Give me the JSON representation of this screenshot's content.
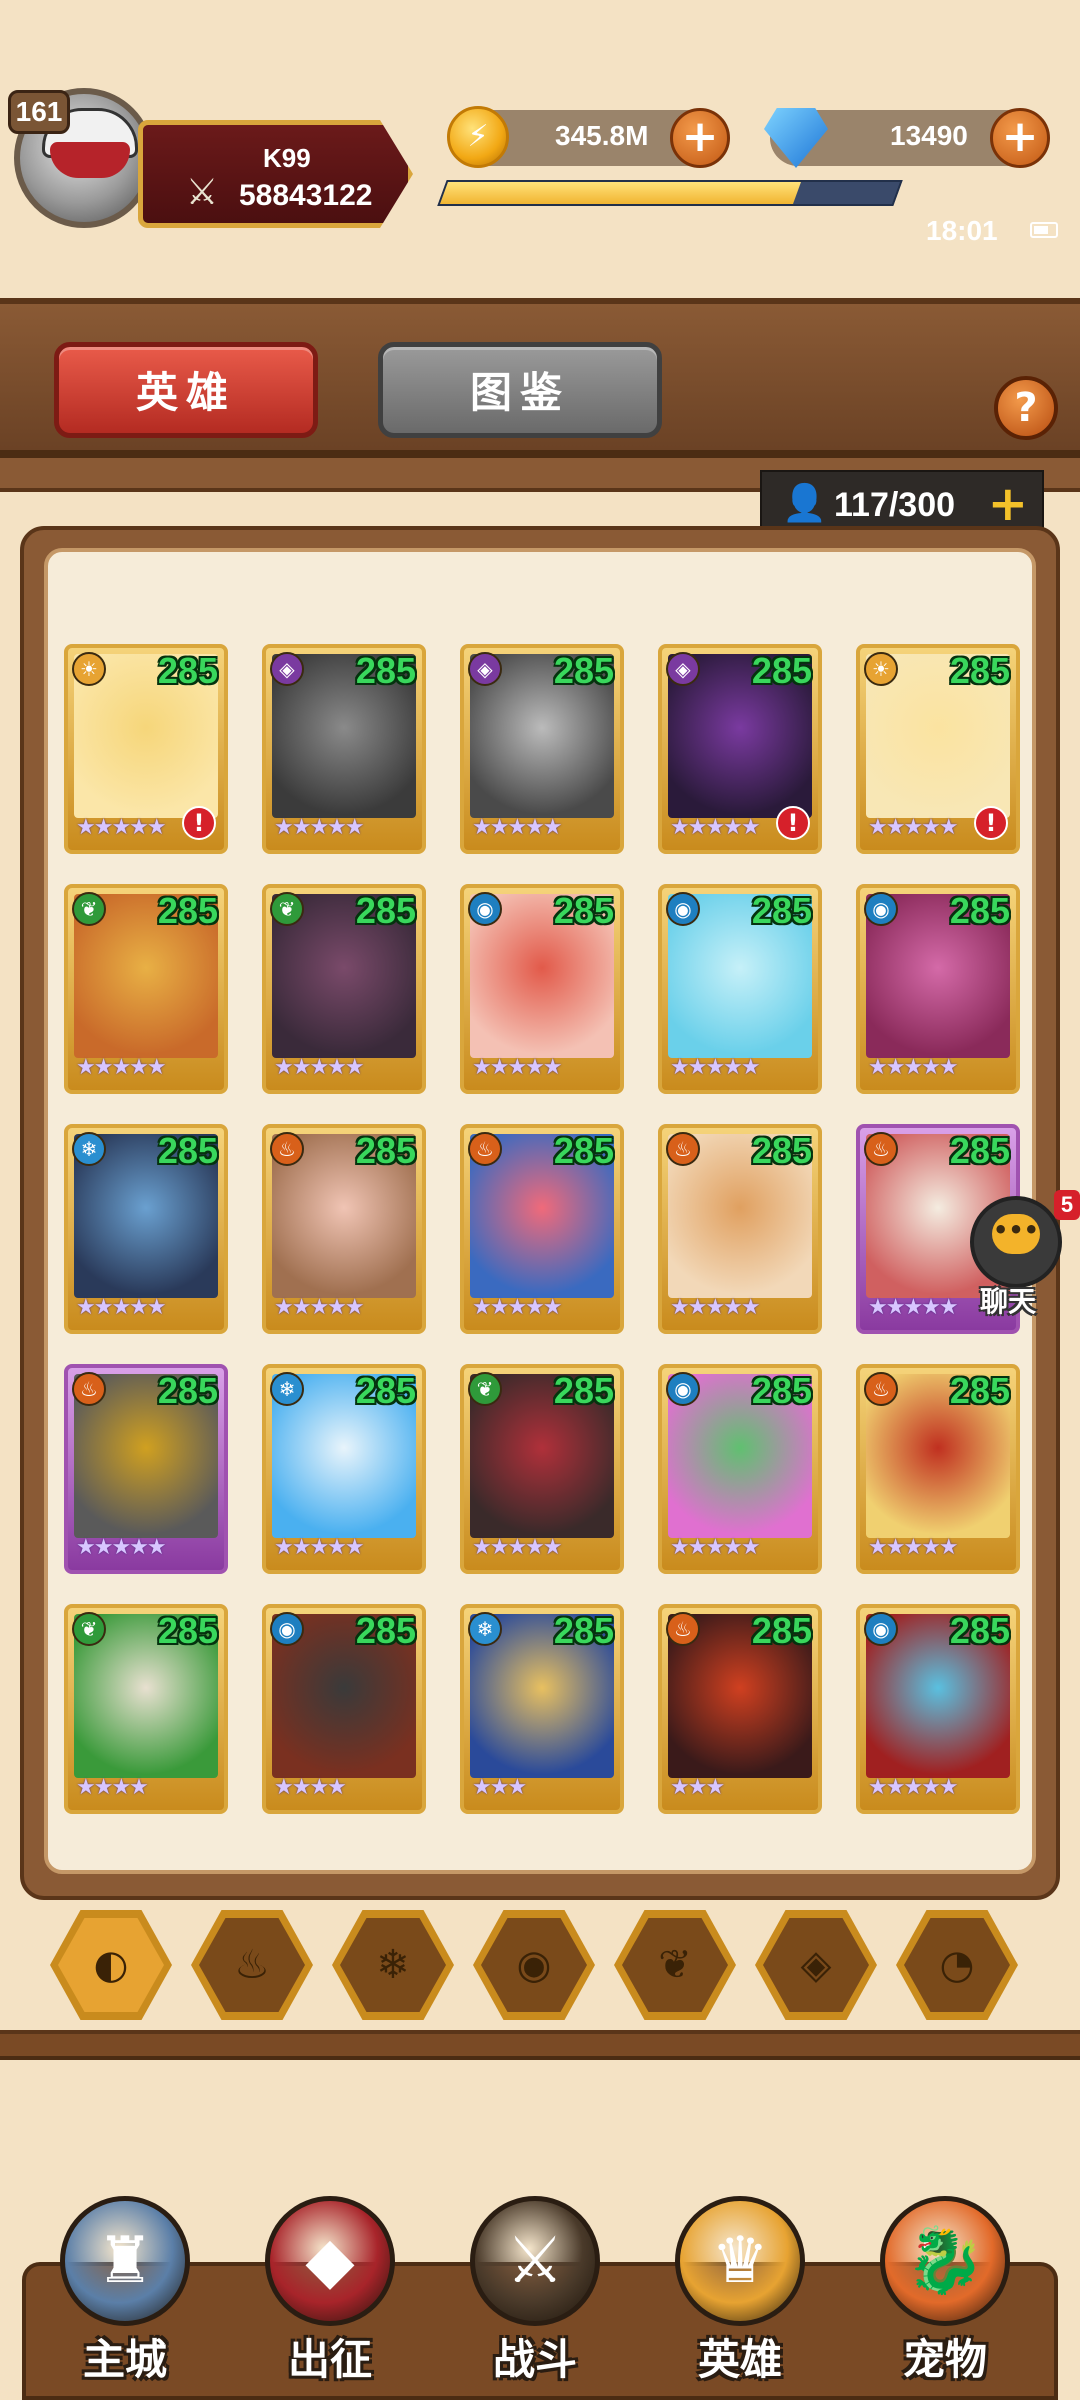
{
  "player": {
    "level": "161",
    "name": "K99",
    "power": "58843122",
    "exp_fraction": 0.78
  },
  "resources": {
    "gold": "345.8M",
    "gems": "13490"
  },
  "status": {
    "time": "18:01"
  },
  "tabs": {
    "heroes": "英雄",
    "codex": "图鉴",
    "help": "?"
  },
  "capacity": {
    "value": "117/300",
    "plus": "+"
  },
  "chat": {
    "label": "聊天",
    "count": "5"
  },
  "heroes": [
    {
      "level": "285",
      "element": "light",
      "stars": "★★★★★",
      "alert": true,
      "frame": "gold"
    },
    {
      "level": "285",
      "element": "dark",
      "stars": "★★★★★",
      "alert": false,
      "frame": "gold"
    },
    {
      "level": "285",
      "element": "dark",
      "stars": "★★★★★",
      "alert": false,
      "frame": "gold"
    },
    {
      "level": "285",
      "element": "dark",
      "stars": "★★★★★",
      "alert": true,
      "frame": "gold"
    },
    {
      "level": "285",
      "element": "light",
      "stars": "★★★★★",
      "alert": true,
      "frame": "gold"
    },
    {
      "level": "285",
      "element": "nature",
      "stars": "★★★★★",
      "alert": false,
      "frame": "gold"
    },
    {
      "level": "285",
      "element": "nature",
      "stars": "★★★★★",
      "alert": false,
      "frame": "gold"
    },
    {
      "level": "285",
      "element": "water",
      "stars": "★★★★★",
      "alert": false,
      "frame": "gold"
    },
    {
      "level": "285",
      "element": "water",
      "stars": "★★★★★",
      "alert": false,
      "frame": "gold"
    },
    {
      "level": "285",
      "element": "water",
      "stars": "★★★★★",
      "alert": false,
      "frame": "gold"
    },
    {
      "level": "285",
      "element": "ice",
      "stars": "★★★★★",
      "alert": false,
      "frame": "gold"
    },
    {
      "level": "285",
      "element": "fire",
      "stars": "★★★★★",
      "alert": false,
      "frame": "gold"
    },
    {
      "level": "285",
      "element": "fire",
      "stars": "★★★★★",
      "alert": false,
      "frame": "gold"
    },
    {
      "level": "285",
      "element": "fire",
      "stars": "★★★★★",
      "alert": false,
      "frame": "gold"
    },
    {
      "level": "285",
      "element": "fire",
      "stars": "★★★★★",
      "alert": false,
      "frame": "purple"
    },
    {
      "level": "285",
      "element": "fire",
      "stars": "★★★★★",
      "alert": false,
      "frame": "purple"
    },
    {
      "level": "285",
      "element": "ice",
      "stars": "★★★★★",
      "alert": false,
      "frame": "gold"
    },
    {
      "level": "285",
      "element": "nature",
      "stars": "★★★★★",
      "alert": false,
      "frame": "gold"
    },
    {
      "level": "285",
      "element": "water",
      "stars": "★★★★★",
      "alert": false,
      "frame": "gold"
    },
    {
      "level": "285",
      "element": "fire",
      "stars": "★★★★★",
      "alert": false,
      "frame": "gold"
    },
    {
      "level": "285",
      "element": "nature",
      "stars": "★★★★",
      "alert": false,
      "frame": "gold"
    },
    {
      "level": "285",
      "element": "water",
      "stars": "★★★★",
      "alert": false,
      "frame": "gold"
    },
    {
      "level": "285",
      "element": "ice",
      "stars": "★★★",
      "alert": false,
      "frame": "gold"
    },
    {
      "level": "285",
      "element": "fire",
      "stars": "★★★",
      "alert": false,
      "frame": "gold"
    },
    {
      "level": "285",
      "element": "water",
      "stars": "★★★★★",
      "alert": false,
      "frame": "gold"
    }
  ],
  "element_colors": {
    "light": "#e7a332",
    "dark": "#7a3aa0",
    "nature": "#2f9a3a",
    "water": "#1e7fc0",
    "ice": "#2a8fd0",
    "fire": "#d8601a"
  },
  "filters": [
    {
      "name": "all",
      "icon": "◐"
    },
    {
      "name": "fire",
      "icon": "♨"
    },
    {
      "name": "ice",
      "icon": "❄"
    },
    {
      "name": "water",
      "icon": "◉"
    },
    {
      "name": "nature",
      "icon": "❦"
    },
    {
      "name": "dark",
      "icon": "◈"
    },
    {
      "name": "light",
      "icon": "◔"
    }
  ],
  "nav": [
    {
      "label": "主城",
      "color": "#5b7fa8"
    },
    {
      "label": "出征",
      "color": "#a8242a"
    },
    {
      "label": "战斗",
      "color": "#4a3a2a"
    },
    {
      "label": "英雄",
      "color": "#e7a332"
    },
    {
      "label": "宠物",
      "color": "#e26a2a"
    }
  ]
}
